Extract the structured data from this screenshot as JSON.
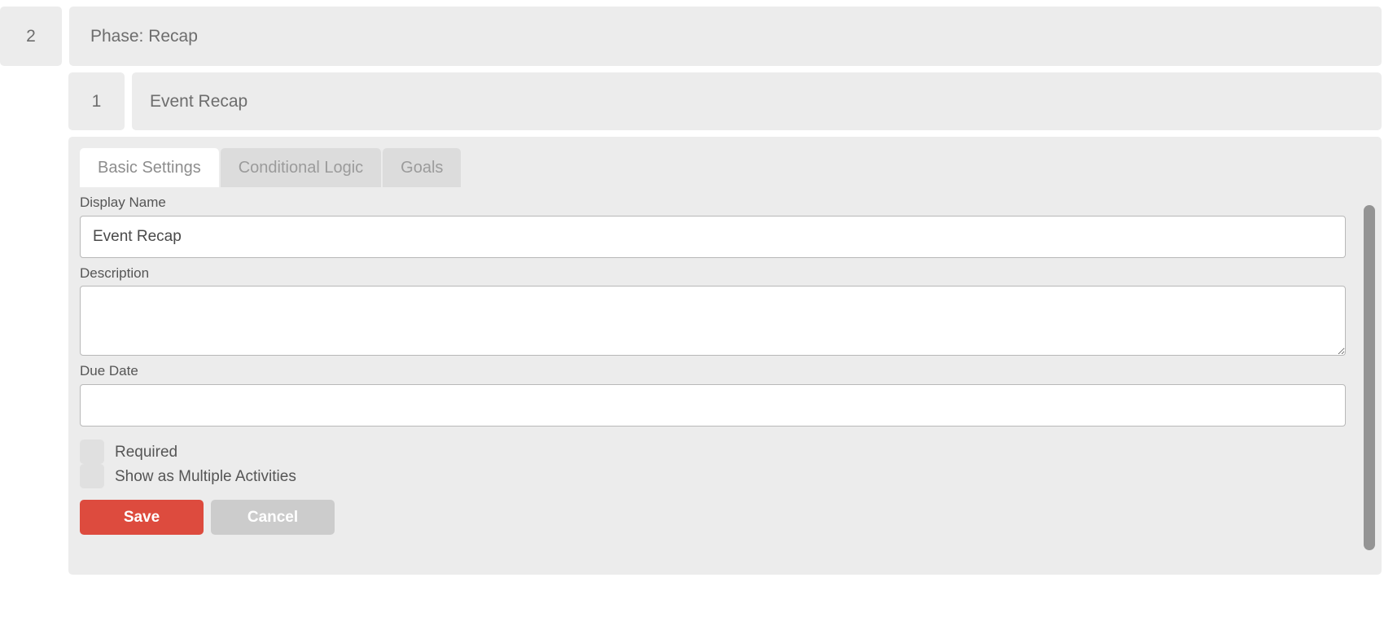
{
  "phase": {
    "number": "2",
    "title": "Phase: Recap"
  },
  "activity": {
    "number": "1",
    "title": "Event Recap"
  },
  "settings": {
    "tabs": [
      {
        "label": "Basic Settings",
        "active": true
      },
      {
        "label": "Conditional Logic",
        "active": false
      },
      {
        "label": "Goals",
        "active": false
      }
    ],
    "fields": {
      "display_name": {
        "label": "Display Name",
        "value": "Event Recap",
        "placeholder": ""
      },
      "description": {
        "label": "Description",
        "value": "",
        "placeholder": ""
      },
      "due_date": {
        "label": "Due Date",
        "value": "",
        "placeholder": ""
      }
    },
    "checkboxes": [
      {
        "label": "Required",
        "checked": false
      },
      {
        "label": "Show as Multiple Activities",
        "checked": false
      }
    ],
    "buttons": {
      "save": "Save",
      "cancel": "Cancel"
    }
  },
  "colors": {
    "panel_background": "#ececec",
    "save_button": "#dd4b3e",
    "cancel_button": "#cccccc",
    "tab_inactive": "#dcdcdc",
    "tab_active": "#ffffff",
    "text": "#6d6d6d",
    "scrollbar_thumb": "#949494"
  }
}
